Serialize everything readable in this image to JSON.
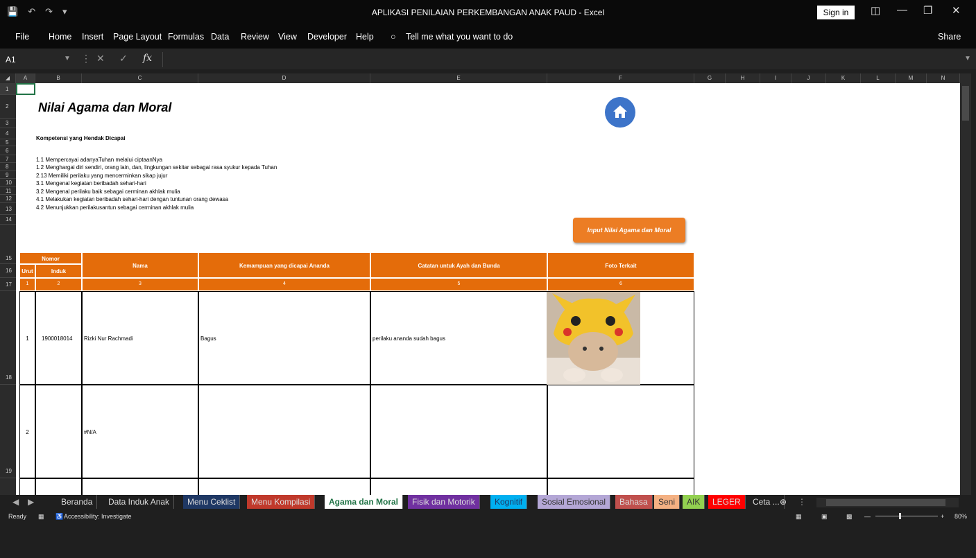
{
  "app": {
    "title": "APLIKASI PENILAIAN PERKEMBANGAN ANAK PAUD  -  Excel",
    "signin": "Sign in"
  },
  "menu": [
    "File",
    "Home",
    "Insert",
    "Page Layout",
    "Formulas",
    "Data",
    "Review",
    "View",
    "Developer",
    "Help",
    "Tell me what you want to do",
    "Share"
  ],
  "formula": {
    "namebox": "A1",
    "fx": "fx",
    "value": ""
  },
  "columns": [
    "A",
    "B",
    "C",
    "D",
    "E",
    "F",
    "G",
    "H",
    "I",
    "J",
    "K",
    "L",
    "M",
    "N"
  ],
  "rows": [
    "1",
    "2",
    "3",
    "4",
    "5",
    "6",
    "7",
    "8",
    "9",
    "10",
    "11",
    "12",
    "13",
    "14",
    "15",
    "16",
    "17",
    "18",
    "19"
  ],
  "sheet": {
    "title": "Nilai Agama dan Moral",
    "komp_title": "Kompetensi yang Hendak Dicapai",
    "komp": [
      "1.1  Mempercayai adanyaTuhan melalui ciptaanNya",
      "1.2  Menghargai  diri sendiri, orang lain, dan,  lingkungan sekitar sebagai rasa syukur kepada Tuhan",
      "2.13 Memiliki perilaku yang mencerminkan sikap jujur",
      "3.1  Mengenal kegiatan beribadah sehari-hari",
      "3.2  Mengenal perilaku baik sebagai cerminan akhlak mulia",
      "4.1  Melakukan kegiatan beribadah sehari-hari dengan tuntunan orang dewasa",
      "4.2  Menunjukkan perilakusantun sebagai cerminan akhlak mulia"
    ],
    "input_button": "Input Nilai Agama dan Moral"
  },
  "table": {
    "h_nomor": "Nomor",
    "h_urut": "Urut",
    "h_induk": "Induk",
    "h_nama": "Nama",
    "h_kemampuan": "Kemampuan yang dicapai Ananda",
    "h_catatan": "Catatan untuk Ayah dan Bunda",
    "h_foto": "Foto Terkait",
    "nums": [
      "1",
      "2",
      "3",
      "4",
      "5",
      "6"
    ],
    "rows": [
      {
        "urut": "1",
        "induk": "1900018014",
        "nama": "Rizki Nur Rachmadi",
        "kemampuan": "Bagus",
        "catatan": "perilaku ananda sudah bagus"
      },
      {
        "urut": "2",
        "induk": "",
        "nama": "#N/A",
        "kemampuan": "",
        "catatan": ""
      }
    ]
  },
  "tabs": [
    "Beranda",
    "Data Induk Anak",
    "Menu Ceklist",
    "Menu Kompilasi",
    "Agama dan Moral",
    "Fisik dan Motorik",
    "Kognitif",
    "Sosial Emosional",
    "Bahasa",
    "Seni",
    "AIK",
    "LEGER",
    "Ceta ..."
  ],
  "status": {
    "ready": "Ready",
    "accessibility": "Accessibility: Investigate",
    "zoom": "80%"
  },
  "colors": {
    "orange": "#e46c0a",
    "accent_blue": "#3d74c9"
  }
}
